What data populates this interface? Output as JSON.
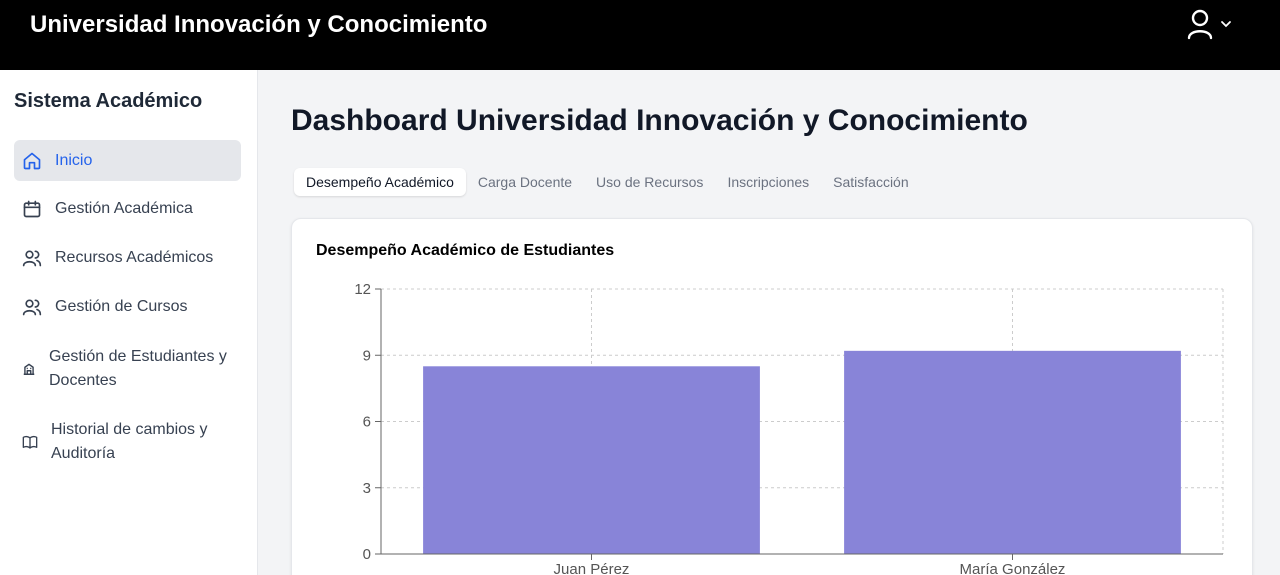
{
  "header": {
    "app_title": "Universidad Innovación y Conocimiento",
    "user_icon": "user-icon",
    "chevron_icon": "chevron-down-icon",
    "background": "#000000"
  },
  "sidebar": {
    "title": "Sistema Académico",
    "items": [
      {
        "label": "Inicio",
        "icon": "home-icon",
        "active": true
      },
      {
        "label": "Gestión Académica",
        "icon": "calendar-icon",
        "active": false
      },
      {
        "label": "Recursos Académicos",
        "icon": "users-icon",
        "active": false
      },
      {
        "label": "Gestión de Cursos",
        "icon": "users-icon",
        "active": false
      },
      {
        "label": "Gestión de Estudiantes y Docentes",
        "icon": "building-icon",
        "active": false
      },
      {
        "label": "Historial de cambios y Auditoría",
        "icon": "book-icon",
        "active": false
      }
    ]
  },
  "main": {
    "title": "Dashboard Universidad Innovación y Conocimiento",
    "tabs": [
      {
        "label": "Desempeño Académico",
        "active": true
      },
      {
        "label": "Carga Docente",
        "active": false
      },
      {
        "label": "Uso de Recursos",
        "active": false
      },
      {
        "label": "Inscripciones",
        "active": false
      },
      {
        "label": "Satisfacción",
        "active": false
      }
    ],
    "card_title": "Desempeño Académico de Estudiantes"
  },
  "chart_data": {
    "type": "bar",
    "title": "Desempeño Académico de Estudiantes",
    "categories": [
      "Juan Pérez",
      "María González"
    ],
    "values": [
      8.5,
      9.2
    ],
    "xlabel": "",
    "ylabel": "",
    "ylim": [
      0,
      12
    ],
    "yticks": [
      0,
      3,
      6,
      9,
      12
    ],
    "grid": true,
    "bar_color": "#8884d8"
  }
}
